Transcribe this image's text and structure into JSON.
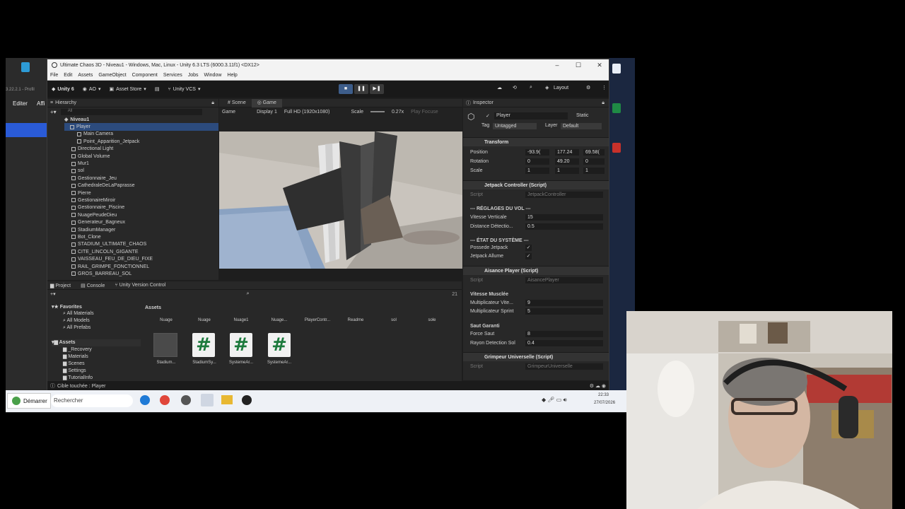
{
  "window": {
    "title": "Ultimate Chaos 3D - Niveau1 - Windows, Mac, Linux - Unity 6.3 LTS (6000.3.11f1) <DX12>"
  },
  "menu": [
    "File",
    "Edit",
    "Assets",
    "GameObject",
    "Component",
    "Services",
    "Jobs",
    "Window",
    "Help"
  ],
  "toolbar": {
    "unity": "Unity 6",
    "ao": "AO",
    "asset_store": "Asset Store",
    "vcs": "Unity VCS",
    "layout": "Layout"
  },
  "hierarchy": {
    "title": "Hierarchy",
    "search": "All",
    "scene": "Niveau1",
    "items": [
      "Player",
      "Main Camera",
      "Point_Apparition_Jetpack",
      "Directional Light",
      "Global Volume",
      "Mur1",
      "sol",
      "Gestionnaire_Jeu",
      "CathedraleDeLaPaprasse",
      "Pierre",
      "GestionaireMiroir",
      "Gestionnaire_Piscine",
      "NuagePeudeDieu",
      "Generateur_Bagneux",
      "StadiumManager",
      "Bot_Clone",
      "STADIUM_ULTIMATE_CHAOS",
      "CITE_LINCOLN_GIGANTE",
      "VAISSEAU_FEU_DE_DIEU_FIXE",
      "RAIL_GRIMPE_FONCTIONNEL",
      "GROS_BARREAU_SOL"
    ]
  },
  "tabs": {
    "scene": "Scene",
    "game": "Game"
  },
  "game": {
    "display_mode": "Game",
    "display": "Display 1",
    "resolution": "Full HD (1920x1080)",
    "scale_label": "Scale",
    "scale_value": "0.27x",
    "play_focused": "Play Focuse"
  },
  "project": {
    "tabs": [
      "Project",
      "Console",
      "Unity Version Control"
    ],
    "favorites": [
      "Favorites",
      "All Materials",
      "All Models",
      "All Prefabs"
    ],
    "assets_tree": [
      "Assets",
      "_Recovery",
      "Materials",
      "Scenes",
      "Settings",
      "TutorialInfo"
    ],
    "breadcrumb": "Assets",
    "top_assets": [
      "Nuage",
      "Nuage",
      "Nuage1",
      "Nuage...",
      "PlayerContr...",
      "Readme",
      "sol",
      "sole"
    ],
    "bottom_assets": [
      "Stadium...",
      "StadiumSy...",
      "SystemeAr...",
      "SystemeAr..."
    ],
    "count": "21"
  },
  "inspector": {
    "title": "Inspector",
    "object_name": "Player",
    "static": "Static",
    "tag_label": "Tag",
    "tag": "Untagged",
    "layer_label": "Layer",
    "layer": "Default",
    "transform": {
      "title": "Transform",
      "position": {
        "label": "Position",
        "x": "-93.9(",
        "y": "177.24",
        "z": "69.58("
      },
      "rotation": {
        "label": "Rotation",
        "x": "0",
        "y": "49.20",
        "z": "0"
      },
      "scale": {
        "label": "Scale",
        "x": "1",
        "y": "1",
        "z": "1"
      }
    },
    "jetpack": {
      "title": "Jetpack Controller (Script)",
      "script_label": "Script",
      "script": "JetpackController",
      "section1": "--- RÉGLAGES DU VOL ---",
      "vitesse_label": "Vitesse Verticale",
      "vitesse": "15",
      "distance_label": "Distance Détectio...",
      "distance": "0.5",
      "section2": "--- ÉTAT DU SYSTÈME ---",
      "possede_label": "Possede Jetpack",
      "allume_label": "Jetpack Allume"
    },
    "aisance": {
      "title": "Aisance Player (Script)",
      "script_label": "Script",
      "script": "AisancePlayer",
      "section1": "Vitesse Musclée",
      "mult_vit_label": "Multiplicateur Vite...",
      "mult_vit": "9",
      "mult_sprint_label": "Multiplicateur Sprint",
      "mult_sprint": "5",
      "section2": "Saut Garanti",
      "force_label": "Force Saut",
      "force": "8",
      "rayon_label": "Rayon Detection Sol",
      "rayon": "0.4"
    },
    "grimpeur": {
      "title": "Grimpeur Universelle (Script)",
      "script_label": "Script",
      "script": "GrimpeurUniverselle"
    }
  },
  "status": {
    "message": "Cible touchée : Player"
  },
  "taskbar": {
    "start": "Démarrer",
    "search": "Rechercher",
    "time": "22:33",
    "date": "27/07/2026"
  },
  "desktop": {
    "left_labels": [
      "Editer",
      "Affi"
    ],
    "left_version": "3.22.2.1 - Profil"
  }
}
